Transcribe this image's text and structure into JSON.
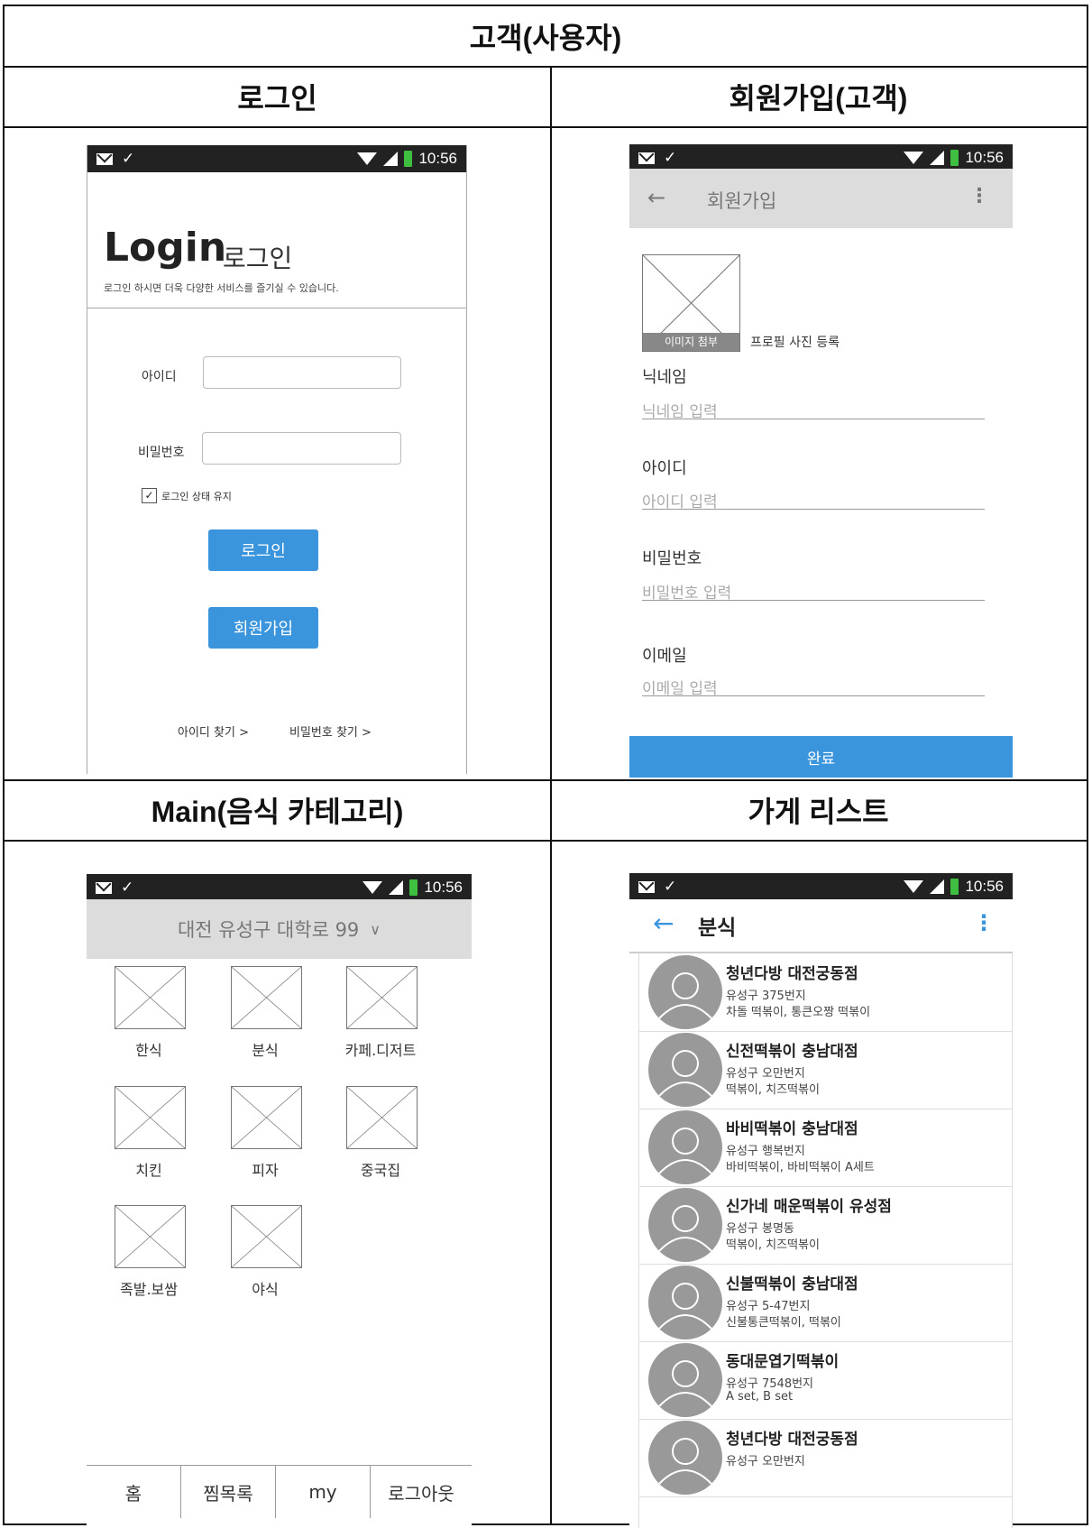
{
  "headers": {
    "main_title": "고객(사용자)",
    "login": "로그인",
    "signup": "회원가입(고객)",
    "main": "Main(음식 카테고리)",
    "store_list": "가게 리스트"
  },
  "status_time": "10:56",
  "login_screen": {
    "title_en": "Login",
    "title_ko": "로그인",
    "subtitle": "로그인 하시면 더욱 다양한 서비스를 즐기실 수 있습니다.",
    "id_label": "아이디",
    "pw_label": "비밀번호",
    "keep_login": "로그인 상태 유지",
    "keep_login_checked": true,
    "login_button": "로그인",
    "signup_button": "회원가입",
    "find_id": "아이디 찾기 >",
    "find_pw": "비밀번호 찾기 >"
  },
  "signup_screen": {
    "back_icon": "arrow-left-icon",
    "title": "회원가입",
    "menu_icon": "more-vertical-icon",
    "image_attach": "이미지 첨부",
    "profile_photo": "프로필 사진 등록",
    "fields": [
      {
        "label": "닉네임",
        "placeholder": "닉네임 입력"
      },
      {
        "label": "아이디",
        "placeholder": "아이디 입력"
      },
      {
        "label": "비밀번호",
        "placeholder": "비밀번호 입력"
      },
      {
        "label": "이메일",
        "placeholder": "이메일 입력"
      }
    ],
    "done_button": "완료"
  },
  "main_screen": {
    "location": "대전 유성구 대학로 99",
    "location_icon": "chevron-down-icon",
    "categories": [
      "한식",
      "분식",
      "카페.디저트",
      "치킨",
      "피자",
      "중국집",
      "족발.보쌈",
      "야식"
    ],
    "tabs": [
      "홈",
      "찜목록",
      "my",
      "로그아웃"
    ]
  },
  "list_screen": {
    "title": "분식",
    "back_icon": "arrow-left-icon",
    "menu_icon": "more-vertical-icon",
    "stores": [
      {
        "name": "청년다방 대전궁동점",
        "address": "유성구 375번지",
        "menu": "차돌 떡볶이, 통큰오짱 떡볶이"
      },
      {
        "name": "신전떡볶이 충남대점",
        "address": "유성구 오만번지",
        "menu": "떡볶이, 치즈떡볶이"
      },
      {
        "name": "바비떡볶이 충남대점",
        "address": "유성구 행복번지",
        "menu": "바비떡볶이, 바비떡볶이 A세트"
      },
      {
        "name": "신가네 매운떡볶이 유성점",
        "address": "유성구 봉명동",
        "menu": "떡볶이, 치즈떡볶이"
      },
      {
        "name": "신불떡볶이 충남대점",
        "address": "유성구 5-47번지",
        "menu": "신불통큰떡볶이, 떡볶이"
      },
      {
        "name": "동대문엽기떡볶이",
        "address": "유성구 7548번지",
        "menu": "A set, B set"
      },
      {
        "name": "청년다방 대전궁동점",
        "address": "유성구 오만번지",
        "menu": ""
      }
    ]
  }
}
